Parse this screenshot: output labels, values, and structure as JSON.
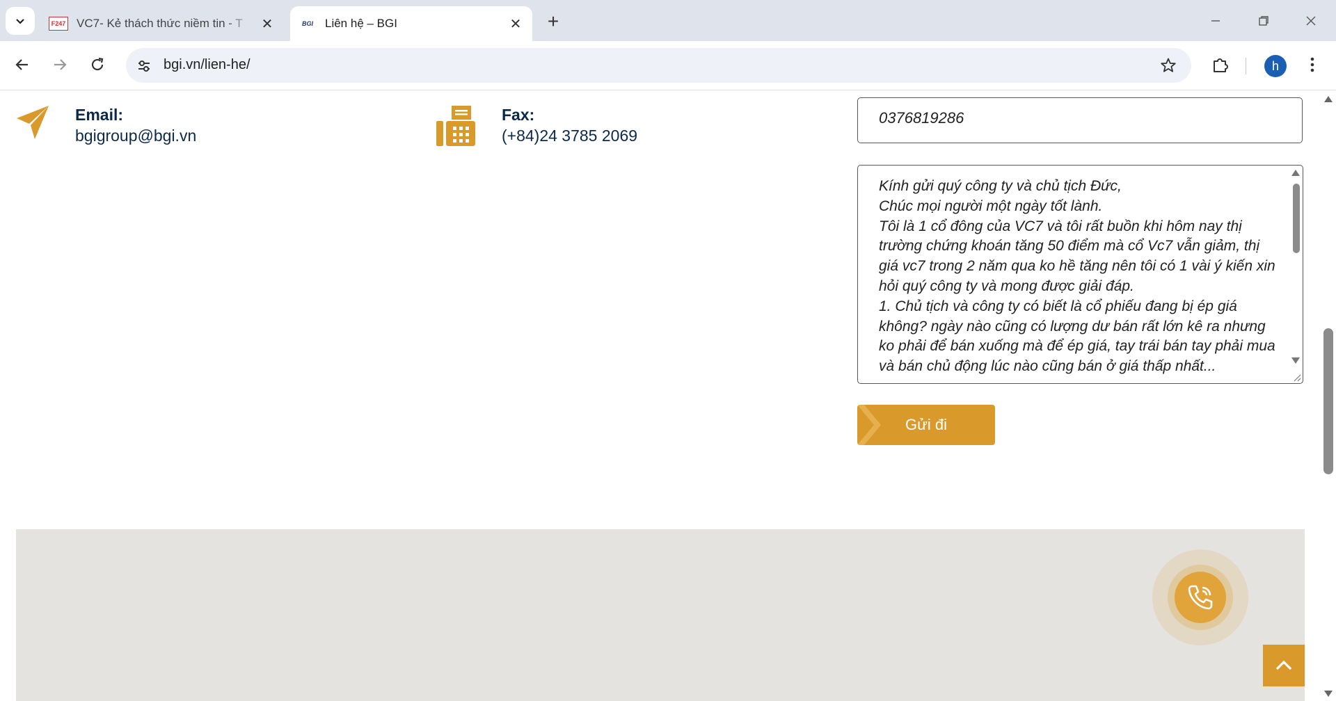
{
  "browser": {
    "tabs": [
      {
        "title": "VC7- Kẻ thách thức niềm tin - T",
        "favicon": "F247",
        "active": false
      },
      {
        "title": "Liên hệ – BGI",
        "favicon": "BGI",
        "active": true
      }
    ],
    "url": "bgi.vn/lien-he/",
    "profile_initial": "h"
  },
  "contact": {
    "email": {
      "label": "Email:",
      "value": "bgigroup@bgi.vn",
      "icon": "paper-plane-icon"
    },
    "fax": {
      "label": "Fax:",
      "value": "(+84)24 3785 2069",
      "icon": "fax-icon"
    }
  },
  "form": {
    "phone_value": "0376819286",
    "message_lines": [
      "Kính gửi quý công ty và chủ tịch Đức,",
      "Chúc mọi người một ngày tốt lành.",
      "Tôi là 1 cổ đông của VC7 và tôi rất buồn khi hôm nay thị trường chứng khoán tăng 50 điểm mà cổ Vc7 vẫn giảm, thị giá vc7 trong 2 năm qua ko hề tăng nên tôi có 1 vài ý kiến xin hỏi quý công ty và mong được giải đáp.",
      "1. Chủ tịch và công ty có biết là cổ phiếu đang bị ép giá không? ngày nào cũng có lượng dư bán rất lớn kê ra nhưng ko phải để bán xuống mà để ép giá, tay trái bán tay phải mua và bán chủ động lúc nào cũng bán ở giá thấp nhất..."
    ],
    "submit_label": "Gửi đi"
  },
  "colors": {
    "accent": "#d99a2b",
    "text_dark": "#0b2a4a",
    "map_bg": "#e5e3df"
  }
}
